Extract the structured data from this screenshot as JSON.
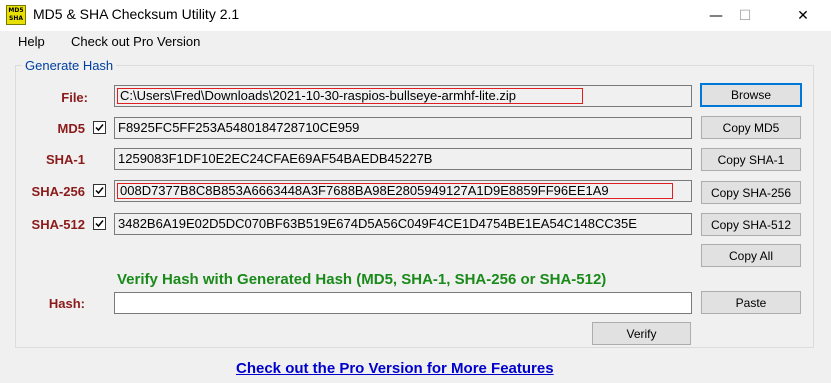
{
  "window": {
    "title": "MD5 & SHA Checksum Utility 2.1",
    "icon_text_top": "MD5",
    "icon_text_bottom": "SHA",
    "minimize": "—",
    "maximize": "☐",
    "close": "✕"
  },
  "menu": {
    "help": "Help",
    "pro": "Check out Pro Version"
  },
  "group": {
    "title": "Generate Hash"
  },
  "file": {
    "label": "File:",
    "value": "C:\\Users\\Fred\\Downloads\\2021-10-30-raspios-bullseye-armhf-lite.zip",
    "button": "Browse"
  },
  "md5": {
    "label": "MD5",
    "checked": true,
    "value": "F8925FC5FF253A5480184728710CE959",
    "button": "Copy MD5"
  },
  "sha1": {
    "label": "SHA-1",
    "checked": true,
    "value": "1259083F1DF10E2EC24CFAE69AF54BAEDB45227B",
    "button": "Copy SHA-1"
  },
  "sha256": {
    "label": "SHA-256",
    "checked": true,
    "value": "008D7377B8C8B853A6663448A3F7688BA98E2805949127A1D9E8859FF96EE1A9",
    "button": "Copy SHA-256"
  },
  "sha512": {
    "label": "SHA-512",
    "checked": true,
    "value": "3482B6A19E02D5DC070BF63B519E674D5A56C049F4CE1D4754BE1EA54C148CC35E",
    "button": "Copy SHA-512"
  },
  "copy_all": "Copy All",
  "verify": {
    "heading": "Verify Hash with Generated Hash (MD5, SHA-1, SHA-256 or SHA-512)",
    "hash_label": "Hash:",
    "hash_value": "",
    "paste_button": "Paste",
    "verify_button": "Verify"
  },
  "footer_link": "Check out the Pro Version for More Features",
  "colors": {
    "label_red": "#8b1a1a",
    "heading_green": "#1a8a1a",
    "link_blue": "#0000cc",
    "highlight_red": "#e02020",
    "default_button_blue": "#0078d7"
  }
}
